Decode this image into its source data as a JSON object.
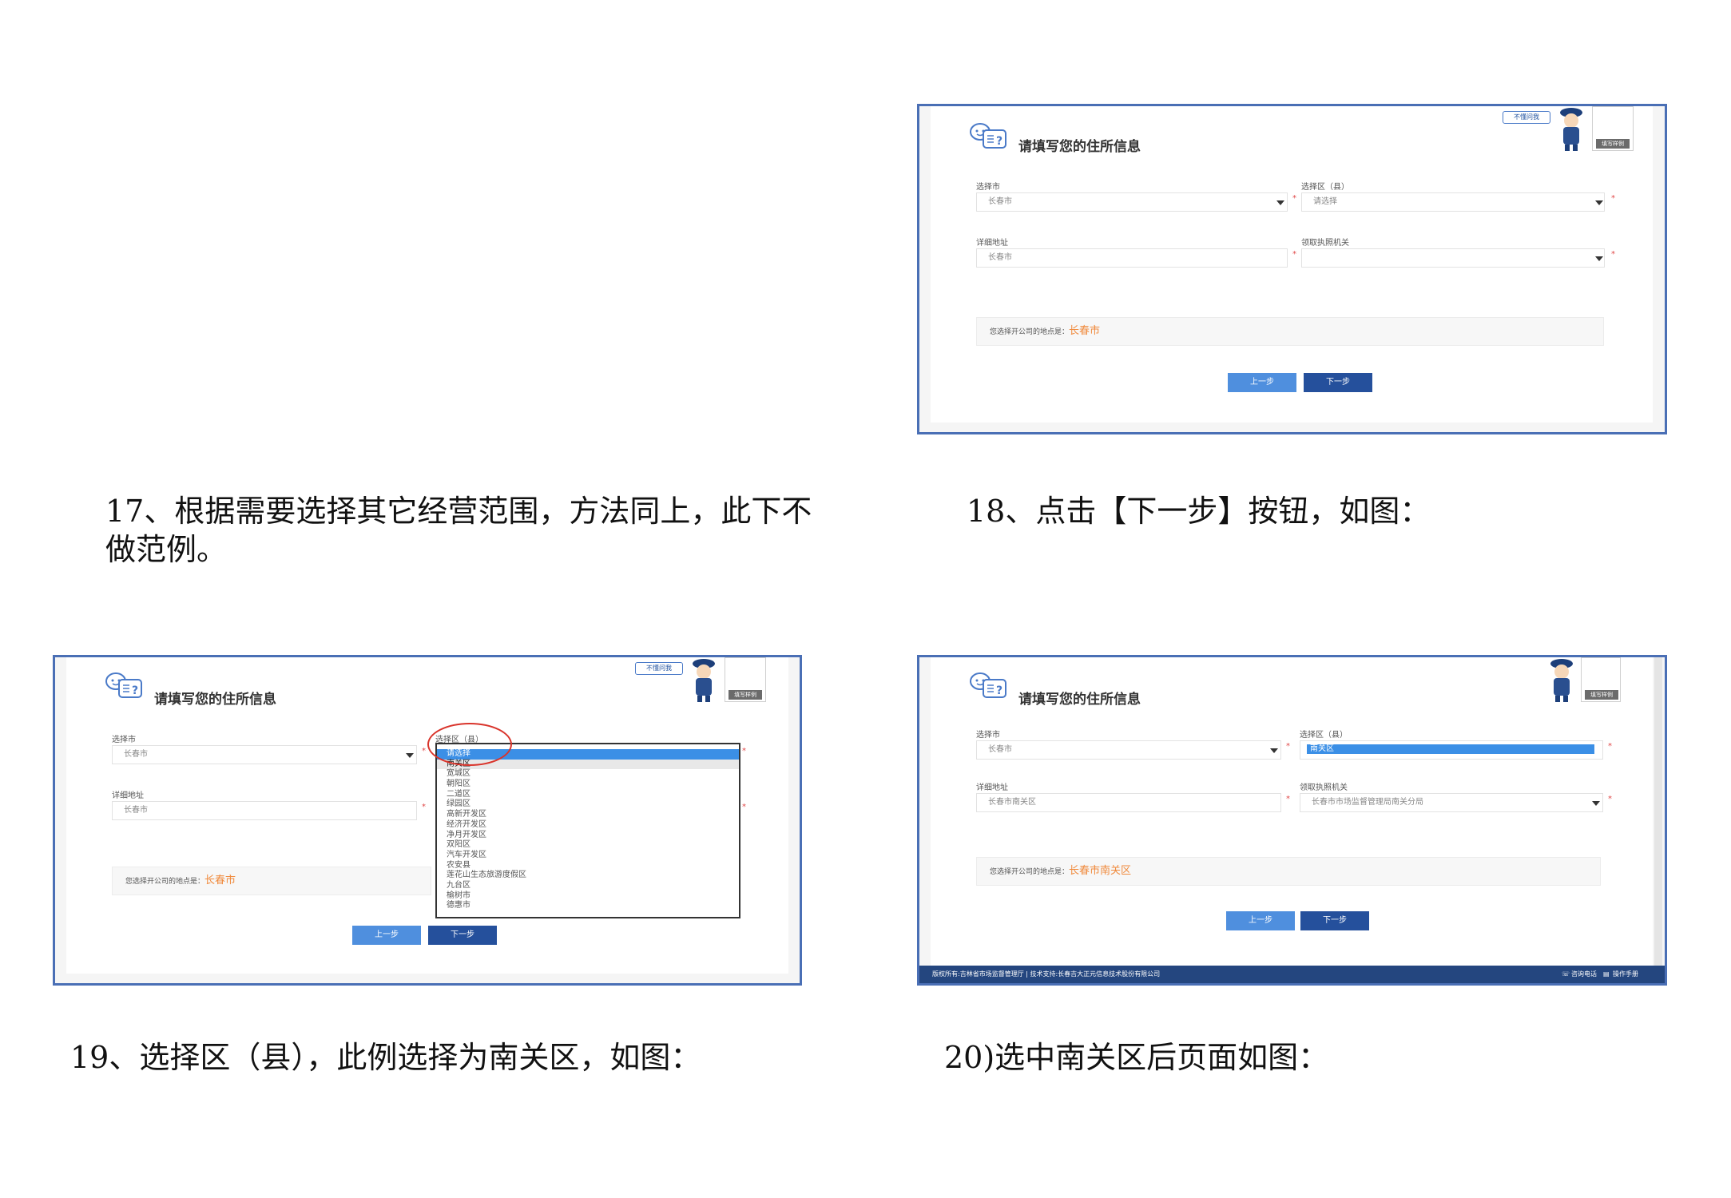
{
  "captions": {
    "c17": "17、根据需要选择其它经营范围，方法同上，此下不做范例。",
    "c17_line1": "17、根据需要选择其它经营范围，方法同上，此下不",
    "c17_line2": "做范例。",
    "c18": "18、点击【下一步】按钮，如图：",
    "c19": "19、选择区（县），此例选择为南关区，如图：",
    "c20": "20)选中南关区后页面如图："
  },
  "form": {
    "title": "请填写您的住所信息",
    "help_badge": "不懂问我",
    "example_label": "填写样例",
    "city_label": "选择市",
    "district_label": "选择区（县）",
    "address_label": "详细地址",
    "office_label": "领取执照机关",
    "required_mark": "*",
    "info_prefix": "您选择开公司的地点是：",
    "prev_button": "上一步",
    "next_button": "下一步"
  },
  "shot18": {
    "city_value": "长春市",
    "district_value": "请选择",
    "address_value": "长春市",
    "office_value": "",
    "location_value": "长春市"
  },
  "shot19": {
    "city_value": "长春市",
    "address_value": "长春市",
    "location_value": "长春市",
    "district_options": [
      "请选择",
      "南关区",
      "宽城区",
      "朝阳区",
      "二道区",
      "绿园区",
      "高新开发区",
      "经济开发区",
      "净月开发区",
      "双阳区",
      "汽车开发区",
      "农安县",
      "莲花山生态旅游度假区",
      "九台区",
      "榆树市",
      "德惠市"
    ]
  },
  "shot20": {
    "city_value": "长春市",
    "district_value": "南关区",
    "address_value": "长春市南关区",
    "office_value": "长春市市场监督管理局南关分局",
    "location_value": "长春市南关区",
    "footer_left": "版权所有:吉林省市场监督管理厅 | 技术支持:长春吉大正元信息技术股份有限公司",
    "footer_phone": "咨询电话",
    "footer_manual": "操作手册"
  },
  "colors": {
    "border": "#4a6fb5",
    "prev_btn": "#4f8fde",
    "next_btn": "#25509c",
    "highlight": "#f08a3c",
    "select_blue": "#3b8fe6",
    "footer": "#24467f",
    "circle": "#d9342b"
  }
}
